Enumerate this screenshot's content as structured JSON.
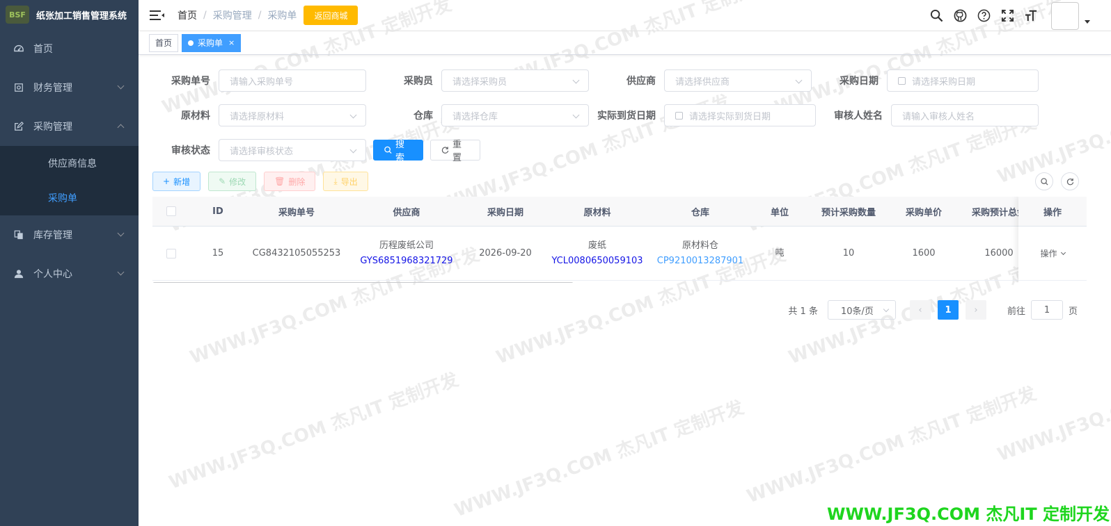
{
  "app": {
    "title": "纸张加工销售管理系统",
    "logo_text": "BSF"
  },
  "sidebar": {
    "items": [
      {
        "label": "首页",
        "icon": "dashboard-icon",
        "expandable": false
      },
      {
        "label": "财务管理",
        "icon": "finance-icon",
        "expandable": true
      },
      {
        "label": "采购管理",
        "icon": "edit-icon",
        "expandable": true,
        "expanded": true,
        "children": [
          {
            "label": "供应商信息"
          },
          {
            "label": "采购单",
            "active": true
          }
        ]
      },
      {
        "label": "库存管理",
        "icon": "copy-icon",
        "expandable": true
      },
      {
        "label": "个人中心",
        "icon": "user-icon",
        "expandable": true
      }
    ]
  },
  "navbar": {
    "breadcrumb": [
      "首页",
      "/",
      "采购管理",
      "/",
      "采购单"
    ],
    "back_button": "返回商城",
    "icons": [
      "search-icon",
      "github-icon",
      "question-icon",
      "fullscreen-icon",
      "font-size-icon"
    ]
  },
  "tags": [
    {
      "label": "首页",
      "active": false
    },
    {
      "label": "采购单",
      "active": true,
      "close": "×"
    }
  ],
  "search_form": {
    "order_no": {
      "label": "采购单号",
      "placeholder": "请输入采购单号"
    },
    "buyer": {
      "label": "采购员",
      "placeholder": "请选择采购员"
    },
    "supplier": {
      "label": "供应商",
      "placeholder": "请选择供应商"
    },
    "purchase_date": {
      "label": "采购日期",
      "placeholder": "请选择采购日期"
    },
    "material": {
      "label": "原材料",
      "placeholder": "请选择原材料"
    },
    "warehouse": {
      "label": "仓库",
      "placeholder": "请选择仓库"
    },
    "arrival_date": {
      "label": "实际到货日期",
      "placeholder": "请选择实际到货日期"
    },
    "reviewer": {
      "label": "审核人姓名",
      "placeholder": "请输入审核人姓名"
    },
    "review_status": {
      "label": "审核状态",
      "placeholder": "请选择审核状态"
    },
    "search_button": "搜索",
    "reset_button": "重置"
  },
  "toolbar": {
    "add": "新增",
    "edit": "修改",
    "delete": "删除",
    "export": "导出"
  },
  "table": {
    "columns": [
      "ID",
      "采购单号",
      "供应商",
      "采购日期",
      "原材料",
      "仓库",
      "单位",
      "预计采购数量",
      "采购单价",
      "采购预计总金",
      "操作"
    ],
    "rows": [
      {
        "id": "15",
        "order_no": "CG8432105055253",
        "supplier_name": "历程废纸公司",
        "supplier_code": "GYS6851968321729",
        "date": "2026-09-20",
        "material_name": "废纸",
        "material_code": "YCL0080650059103",
        "warehouse_name": "原材料仓",
        "warehouse_code": "CP9210013287901",
        "unit": "吨",
        "quantity": "10",
        "price": "1600",
        "total": "16000",
        "action": "操作"
      }
    ]
  },
  "pagination": {
    "total_text": "共 1 条",
    "page_size": "10条/页",
    "current_page": "1",
    "prev": "‹",
    "next": "›",
    "goto_label": "前往",
    "goto_value": "1",
    "page_suffix": "页"
  },
  "watermark": {
    "text": "WWW.JF3Q.COM 杰凡IT  定制开发",
    "corner_color": "#1ed51e"
  }
}
